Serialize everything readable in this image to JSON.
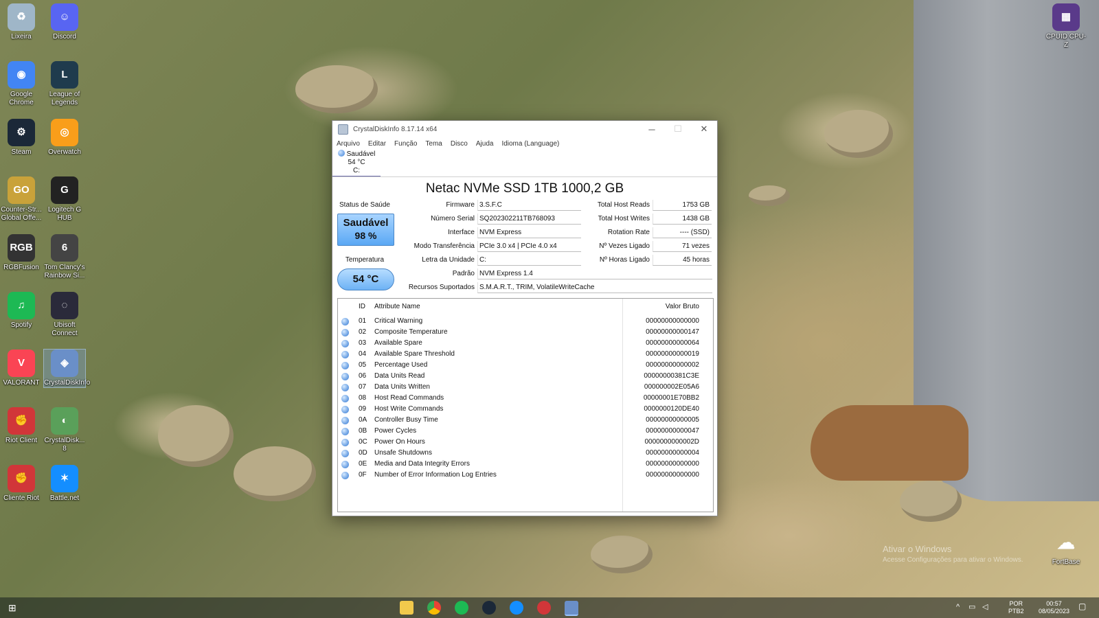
{
  "desktop": {
    "icons": [
      {
        "label": "Lixeira",
        "icon": "recycle-bin-icon",
        "color": "#9fb6c8"
      },
      {
        "label": "Discord",
        "icon": "discord-icon",
        "color": "#5865f2"
      },
      {
        "label": "Google Chrome",
        "icon": "chrome-icon",
        "color": "#4285f4"
      },
      {
        "label": "League of Legends",
        "icon": "league-icon",
        "color": "#1f3b4d"
      },
      {
        "label": "Steam",
        "icon": "steam-icon",
        "color": "#1b2838"
      },
      {
        "label": "Overwatch",
        "icon": "overwatch-icon",
        "color": "#f99e1a"
      },
      {
        "label": "Counter-Str... Global Offe...",
        "icon": "csgo-icon",
        "color": "#c9a23a"
      },
      {
        "label": "Logitech G HUB",
        "icon": "logitech-icon",
        "color": "#222222"
      },
      {
        "label": "RGBFusion",
        "icon": "rgbfusion-icon",
        "color": "#333333"
      },
      {
        "label": "Tom Clancy's Rainbow Si...",
        "icon": "rainbow-six-icon",
        "color": "#444444"
      },
      {
        "label": "Spotify",
        "icon": "spotify-icon",
        "color": "#1db954"
      },
      {
        "label": "Ubisoft Connect",
        "icon": "ubisoft-icon",
        "color": "#2a2a3a"
      },
      {
        "label": "VALORANT",
        "icon": "valorant-icon",
        "color": "#fa4454"
      },
      {
        "label": "CrystalDiskInfo",
        "icon": "crystaldiskinfo-icon",
        "color": "#6a8fc8"
      },
      {
        "label": "Riot Client",
        "icon": "riot-icon",
        "color": "#d13639"
      },
      {
        "label": "CrystalDisk... 8",
        "icon": "crystaldiskmark-icon",
        "color": "#5aa05a"
      },
      {
        "label": "Cliente Riot",
        "icon": "riot-icon",
        "color": "#d13639"
      },
      {
        "label": "Battle.net",
        "icon": "battlenet-icon",
        "color": "#148eff"
      }
    ],
    "right_icons": [
      {
        "label": "CPUID CPU-Z",
        "icon": "cpuz-icon",
        "color": "#5a3a8a"
      },
      {
        "label": "FortBase",
        "icon": "cloud-icon",
        "color": "#ffffff"
      }
    ],
    "watermark": "Ativar o Windows",
    "watermark_sub": "Acesse Configurações para ativar o Windows."
  },
  "window": {
    "title": "CrystalDiskInfo 8.17.14 x64",
    "menu": [
      "Arquivo",
      "Editar",
      "Função",
      "Tema",
      "Disco",
      "Ajuda",
      "Idioma (Language)"
    ],
    "drive_tab": {
      "status": "Saudável",
      "temp": "54 °C",
      "letter": "C:"
    },
    "model": "Netac NVMe SSD 1TB 1000,2 GB",
    "health": {
      "label": "Status de Saúde",
      "status": "Saudável",
      "percent": "98 %",
      "color": "#5aa8f4"
    },
    "temperature": {
      "label": "Temperatura",
      "value": "54 °C"
    },
    "fields": {
      "firmware": {
        "label": "Firmware",
        "value": "3.S.F.C"
      },
      "serial": {
        "label": "Número Serial",
        "value": "SQ202302211TB768093"
      },
      "interface": {
        "label": "Interface",
        "value": "NVM Express"
      },
      "transfer": {
        "label": "Modo Transferência",
        "value": "PCIe 3.0 x4 | PCIe 4.0 x4"
      },
      "drive_letter": {
        "label": "Letra da Unidade",
        "value": "C:"
      },
      "standard": {
        "label": "Padrão",
        "value": "NVM Express 1.4"
      },
      "features": {
        "label": "Recursos Suportados",
        "value": "S.M.A.R.T., TRIM, VolatileWriteCache"
      },
      "host_reads": {
        "label": "Total Host Reads",
        "value": "1753 GB"
      },
      "host_writes": {
        "label": "Total Host Writes",
        "value": "1438 GB"
      },
      "rotation": {
        "label": "Rotation Rate",
        "value": "---- (SSD)"
      },
      "power_count": {
        "label": "Nº Vezes Ligado",
        "value": "71 vezes"
      },
      "power_hours": {
        "label": "Nº Horas Ligado",
        "value": "45 horas"
      }
    },
    "table": {
      "headers": {
        "id": "ID",
        "name": "Attribute Name",
        "raw": "Valor Bruto"
      },
      "rows": [
        {
          "id": "01",
          "name": "Critical Warning",
          "raw": "00000000000000"
        },
        {
          "id": "02",
          "name": "Composite Temperature",
          "raw": "00000000000147"
        },
        {
          "id": "03",
          "name": "Available Spare",
          "raw": "00000000000064"
        },
        {
          "id": "04",
          "name": "Available Spare Threshold",
          "raw": "00000000000019"
        },
        {
          "id": "05",
          "name": "Percentage Used",
          "raw": "00000000000002"
        },
        {
          "id": "06",
          "name": "Data Units Read",
          "raw": "00000000381C3E"
        },
        {
          "id": "07",
          "name": "Data Units Written",
          "raw": "000000002E05A6"
        },
        {
          "id": "08",
          "name": "Host Read Commands",
          "raw": "00000001E70BB2"
        },
        {
          "id": "09",
          "name": "Host Write Commands",
          "raw": "0000000120DE40"
        },
        {
          "id": "0A",
          "name": "Controller Busy Time",
          "raw": "00000000000005"
        },
        {
          "id": "0B",
          "name": "Power Cycles",
          "raw": "00000000000047"
        },
        {
          "id": "0C",
          "name": "Power On Hours",
          "raw": "0000000000002D"
        },
        {
          "id": "0D",
          "name": "Unsafe Shutdowns",
          "raw": "00000000000004"
        },
        {
          "id": "0E",
          "name": "Media and Data Integrity Errors",
          "raw": "00000000000000"
        },
        {
          "id": "0F",
          "name": "Number of Error Information Log Entries",
          "raw": "00000000000000"
        }
      ]
    }
  },
  "taskbar": {
    "apps": [
      "file-explorer-icon",
      "chrome-icon",
      "spotify-icon",
      "steam-icon",
      "battlenet-icon",
      "riot-icon",
      "crystaldiskinfo-icon"
    ],
    "language": "POR",
    "layout": "PTB2",
    "time": "00:57",
    "date": "08/05/2023"
  }
}
